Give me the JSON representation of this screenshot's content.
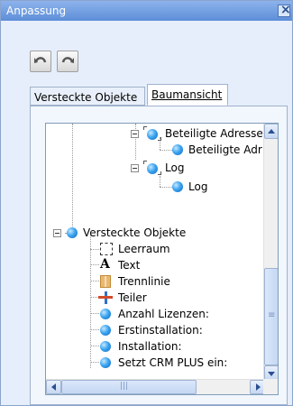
{
  "window": {
    "title": "Anpassung"
  },
  "toolbar": {
    "undo_icon": "undo-arrow-icon",
    "redo_icon": "redo-arrow-icon"
  },
  "tabs": [
    {
      "label": "Versteckte Objekte",
      "active": false
    },
    {
      "label": "Baumansicht",
      "active": true
    }
  ],
  "tree": {
    "nodes": [
      {
        "label": "Beteiligte Adresse",
        "icon": "group-ball-icon"
      },
      {
        "label": "Beteiligte Adr",
        "icon": "blue-ball-icon"
      },
      {
        "label": "Log",
        "icon": "group-ball-icon"
      },
      {
        "label": "Log",
        "icon": "blue-ball-icon"
      },
      {
        "label": "Versteckte Objekte",
        "icon": "blue-ball-icon"
      },
      {
        "label": "Leerraum",
        "icon": "space-icon"
      },
      {
        "label": "Text",
        "icon": "text-icon"
      },
      {
        "label": "Trennlinie",
        "icon": "separator-line-icon"
      },
      {
        "label": "Teiler",
        "icon": "splitter-icon"
      },
      {
        "label": "Anzahl Lizenzen:",
        "icon": "blue-ball-icon"
      },
      {
        "label": "Erstinstallation:",
        "icon": "blue-ball-icon"
      },
      {
        "label": "Installation:",
        "icon": "blue-ball-icon"
      },
      {
        "label": "Setzt CRM PLUS ein:",
        "icon": "blue-ball-icon"
      }
    ]
  },
  "colors": {
    "titlebar": "#5d8ed8",
    "panel": "#e6eefb",
    "accent": "#3da5f0"
  }
}
